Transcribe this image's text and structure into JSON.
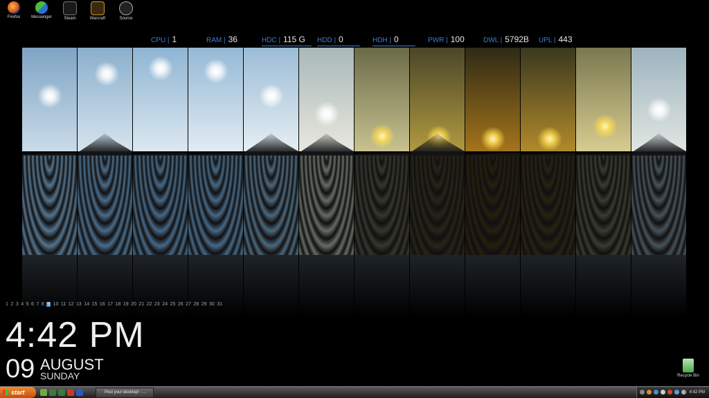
{
  "desktop_icons": [
    {
      "label": "Firefox",
      "icon": "firefox-icon"
    },
    {
      "label": "Messenger",
      "icon": "messenger-icon"
    },
    {
      "label": "Steam",
      "icon": "steam-icon"
    },
    {
      "label": "Warcraft",
      "icon": "warcraft-icon"
    },
    {
      "label": "Source",
      "icon": "source-icon"
    }
  ],
  "stats": [
    {
      "key": "CPU |",
      "value": "1"
    },
    {
      "key": "RAM |",
      "value": "36"
    },
    {
      "key": "HDC |",
      "value": "115 G"
    },
    {
      "key": "HDD |",
      "value": "0"
    },
    {
      "key": "HDH |",
      "value": "0"
    },
    {
      "key": "PWR |",
      "value": "100"
    },
    {
      "key": "DWL |",
      "value": "5792B"
    },
    {
      "key": "UPL |",
      "value": "443"
    }
  ],
  "calendar": {
    "days": [
      "1",
      "2",
      "3",
      "4",
      "5",
      "6",
      "7",
      "8",
      "9",
      "10",
      "11",
      "12",
      "13",
      "14",
      "15",
      "16",
      "17",
      "18",
      "19",
      "20",
      "21",
      "22",
      "23",
      "24",
      "25",
      "26",
      "27",
      "28",
      "29",
      "30",
      "31"
    ],
    "current": "9"
  },
  "clock": {
    "time": "4:42 PM",
    "day": "09",
    "month": "AUGUST",
    "weekday": "SUNDAY"
  },
  "recycle_bin": {
    "label": "Recycle Bin"
  },
  "taskbar": {
    "start_label": "start",
    "window_title": "Post your desktop! - ...",
    "clock": "4:42 PM"
  },
  "colors": {
    "stat_key": "#3f7fcf",
    "start_button": "#e06a1e"
  }
}
